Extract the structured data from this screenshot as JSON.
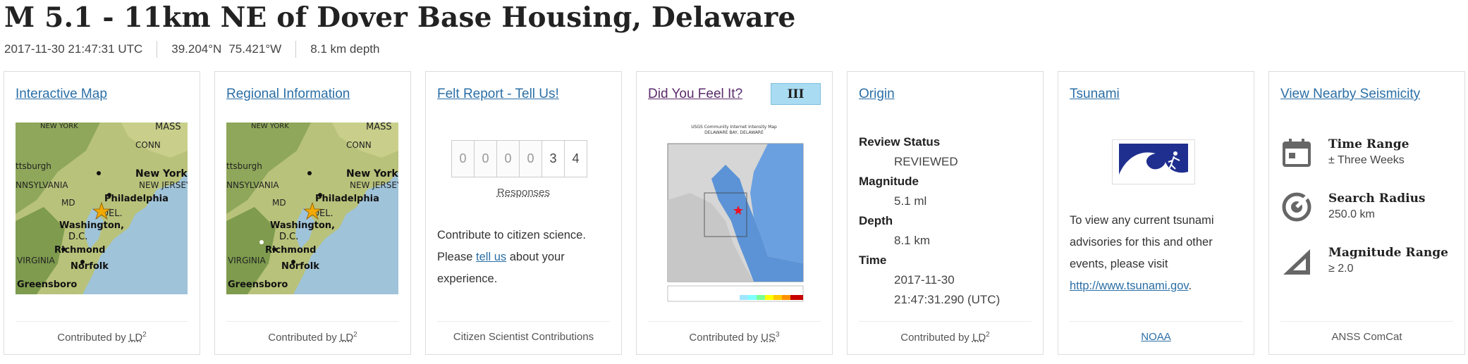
{
  "event": {
    "title": "M 5.1 - 11km NE of Dover Base Housing, Delaware",
    "time": "2017-11-30 21:47:31 UTC",
    "lat": "39.204°N",
    "lon": "75.421°W",
    "depth": "8.1 km depth"
  },
  "cards": {
    "interactive_map": {
      "title": "Interactive Map",
      "contributed_prefix": "Contributed by ",
      "contributor": "LD",
      "contributor_sup": "2",
      "map_labels": [
        "NEW YORK",
        "MASS",
        "CONN",
        "ttsburgh",
        "New York",
        "NNSYLVANIA",
        "NEW JERSEY",
        "Philadelphia",
        "MD",
        "DEL.",
        "Washington,",
        "D.C.",
        "Richmond",
        "VIRGINIA",
        "Norfolk",
        "Greensboro"
      ]
    },
    "regional": {
      "title": "Regional Information",
      "contributed_prefix": "Contributed by ",
      "contributor": "LD",
      "contributor_sup": "2"
    },
    "felt_report": {
      "title": "Felt Report - Tell Us!",
      "digits": [
        "0",
        "0",
        "0",
        "0",
        "3",
        "4"
      ],
      "responses": "Responses",
      "para_line1": "Contribute to citizen science.",
      "para_please": "Please ",
      "para_link": "tell us",
      "para_rest": " about your",
      "para_line3": "experience.",
      "footer": "Citizen Scientist Contributions"
    },
    "dyfi": {
      "title": "Did You Feel It?",
      "mmi": "III",
      "contributed_prefix": "Contributed by ",
      "contributor": "US",
      "contributor_sup": "3",
      "map_title": "USGS Community Internet Intensity Map",
      "map_subtitle": "DELAWARE BAY, DELAWARE"
    },
    "origin": {
      "title": "Origin",
      "review_status_label": "Review Status",
      "review_status": "REVIEWED",
      "magnitude_label": "Magnitude",
      "magnitude": "5.1 ml",
      "depth_label": "Depth",
      "depth": "8.1 km",
      "time_label": "Time",
      "time_date": "2017-11-30",
      "time_clock": "21:47:31.290 (UTC)",
      "contributed_prefix": "Contributed by ",
      "contributor": "LD",
      "contributor_sup": "2"
    },
    "tsunami": {
      "title": "Tsunami",
      "line1": "To view any current tsunami",
      "line2": "advisories for this and other",
      "line3": "events, please visit",
      "link": "http://www.tsunami.gov",
      "link_suffix": ".",
      "footer_link": "NOAA"
    },
    "seismicity": {
      "title": "View Nearby Seismicity",
      "time_range_label": "Time Range",
      "time_range": "± Three Weeks",
      "radius_label": "Search Radius",
      "radius": "250.0 km",
      "mag_range_label": "Magnitude Range",
      "mag_range": "≥ 2.0",
      "footer": "ANSS ComCat"
    }
  },
  "colors": {
    "link": "#2b6fa6",
    "visited": "#5a2b6b",
    "mmi_badge": "#a9dbf2",
    "star": "#f2a900"
  }
}
